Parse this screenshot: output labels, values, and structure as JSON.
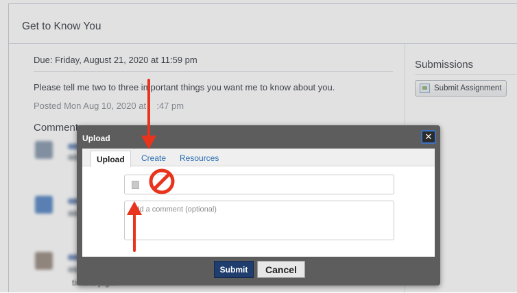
{
  "page": {
    "title": "Get to Know You",
    "due": "Due: Friday, August 21, 2020 at 11:59 pm",
    "instructions": "Please tell me two to three important things you want me to know about you.",
    "posted": "Posted Mon Aug 10, 2020 at",
    "posted_time": ":47 pm",
    "comments_heading": "Comments",
    "obscured_comment_tail": "tima al jugar."
  },
  "sidebar": {
    "submissions_heading": "Submissions",
    "submit_assignment_label": "Submit Assignment"
  },
  "modal": {
    "title": "Upload",
    "close_label": "✕",
    "tabs": [
      {
        "label": "Upload",
        "active": true
      },
      {
        "label": "Create",
        "active": false
      },
      {
        "label": "Resources",
        "active": false
      }
    ],
    "comment_placeholder": "Add a comment (optional)",
    "submit_label": "Submit",
    "cancel_label": "Cancel"
  },
  "annotations": {
    "arrow_color": "#e8341c",
    "no_symbol_color": "#e8341c"
  },
  "colors": {
    "link": "#2a6eb3",
    "modal_chrome": "#5d5d5d",
    "submit_button": "#1f3e6e",
    "close_focus_ring": "#3b73c4"
  }
}
